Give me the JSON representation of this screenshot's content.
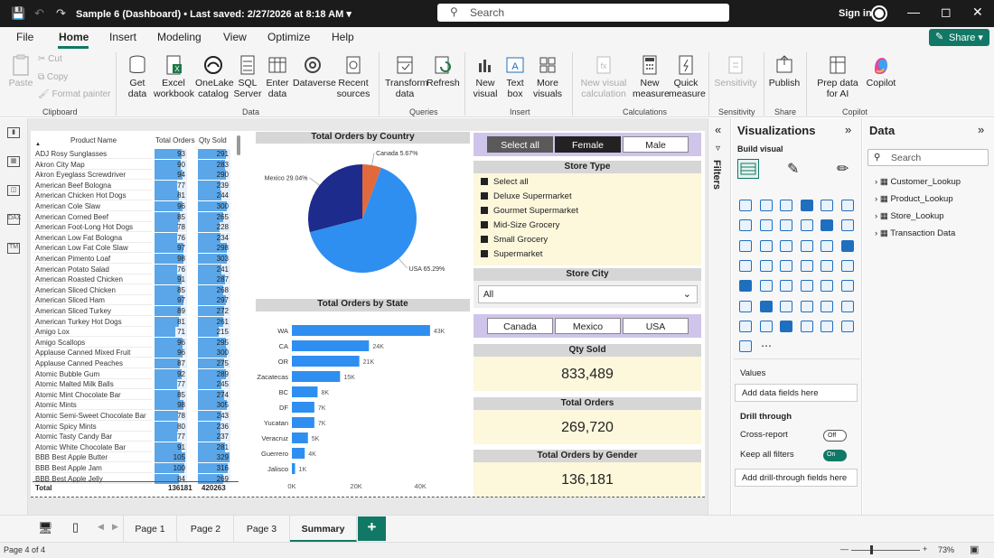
{
  "app": {
    "title": "Sample 6 (Dashboard)",
    "last_saved": "• Last saved: 2/27/2026 at 8:18 AM",
    "search_placeholder": "Search",
    "signin": "Sign in"
  },
  "menu": {
    "tabs": [
      "File",
      "Home",
      "Insert",
      "Modeling",
      "View",
      "Optimize",
      "Help"
    ],
    "active": "Home",
    "share": "Share"
  },
  "ribbon": {
    "clipboard": {
      "paste": "Paste",
      "cut": "Cut",
      "copy": "Copy",
      "format_painter": "Format painter",
      "group": "Clipboard"
    },
    "data": {
      "get_data": "Get data",
      "excel": "Excel workbook",
      "onelake": "OneLake catalog",
      "sql": "SQL Server",
      "enter": "Enter data",
      "dataverse": "Dataverse",
      "recent": "Recent sources",
      "group": "Data"
    },
    "queries": {
      "transform": "Transform data",
      "refresh": "Refresh",
      "group": "Queries"
    },
    "insert": {
      "new_visual": "New visual",
      "text_box": "Text box",
      "more_visuals": "More visuals",
      "group": "Insert"
    },
    "calculations": {
      "new_visual_calc": "New visual calculation",
      "new_measure": "New measure",
      "quick_measure": "Quick measure",
      "group": "Calculations"
    },
    "sensitivity": {
      "sensitivity": "Sensitivity",
      "group": "Sensitivity"
    },
    "share": {
      "publish": "Publish",
      "group": "Share"
    },
    "copilot": {
      "prep": "Prep data for AI",
      "copilot": "Copilot",
      "group": "Copilot"
    }
  },
  "table": {
    "headers": {
      "product": "Product Name",
      "orders": "Total Orders",
      "qty": "Qty Sold"
    },
    "rows": [
      [
        "ADJ Rosy Sunglasses",
        "93",
        "291"
      ],
      [
        "Akron City Map",
        "90",
        "283"
      ],
      [
        "Akron Eyeglass Screwdriver",
        "94",
        "290"
      ],
      [
        "American Beef Bologna",
        "77",
        "239"
      ],
      [
        "American Chicken Hot Dogs",
        "81",
        "244"
      ],
      [
        "American Cole Slaw",
        "96",
        "300"
      ],
      [
        "American Corned Beef",
        "85",
        "265"
      ],
      [
        "American Foot-Long Hot Dogs",
        "78",
        "228"
      ],
      [
        "American Low Fat Bologna",
        "76",
        "234"
      ],
      [
        "American Low Fat Cole Slaw",
        "97",
        "298"
      ],
      [
        "American Pimento Loaf",
        "98",
        "303"
      ],
      [
        "American Potato Salad",
        "76",
        "241"
      ],
      [
        "American Roasted Chicken",
        "91",
        "287"
      ],
      [
        "American Sliced Chicken",
        "85",
        "268"
      ],
      [
        "American Sliced Ham",
        "97",
        "297"
      ],
      [
        "American Sliced Turkey",
        "89",
        "272"
      ],
      [
        "American Turkey Hot Dogs",
        "81",
        "261"
      ],
      [
        "Amigo Lox",
        "71",
        "215"
      ],
      [
        "Amigo Scallops",
        "96",
        "295"
      ],
      [
        "Applause Canned Mixed Fruit",
        "96",
        "300"
      ],
      [
        "Applause Canned Peaches",
        "87",
        "275"
      ],
      [
        "Atomic Bubble Gum",
        "92",
        "289"
      ],
      [
        "Atomic Malted Milk Balls",
        "77",
        "245"
      ],
      [
        "Atomic Mint Chocolate Bar",
        "85",
        "274"
      ],
      [
        "Atomic Mints",
        "98",
        "305"
      ],
      [
        "Atomic Semi-Sweet Chocolate Bar",
        "78",
        "243"
      ],
      [
        "Atomic Spicy Mints",
        "80",
        "236"
      ],
      [
        "Atomic Tasty Candy Bar",
        "77",
        "237"
      ],
      [
        "Atomic White Chocolate Bar",
        "91",
        "281"
      ],
      [
        "BBB Best Apple Butter",
        "105",
        "329"
      ],
      [
        "BBB Best Apple Jam",
        "100",
        "316"
      ],
      [
        "BBB Best Apple Jelly",
        "84",
        "269"
      ]
    ],
    "total": {
      "label": "Total",
      "orders": "136181",
      "qty": "420263"
    }
  },
  "pie": {
    "title": "Total Orders by Country",
    "labels": [
      "Mexico 29.04%",
      "Canada 5.67%",
      "USA 65.29%"
    ]
  },
  "bar": {
    "title": "Total Orders by State",
    "ticks": [
      "0K",
      "20K",
      "40K"
    ]
  },
  "chart_data": [
    {
      "type": "pie",
      "title": "Total Orders by Country",
      "categories": [
        "USA",
        "Mexico",
        "Canada"
      ],
      "values": [
        65.29,
        29.04,
        5.67
      ],
      "colors": [
        "#2f8ff0",
        "#1c2b8c",
        "#e06a3b"
      ]
    },
    {
      "type": "bar",
      "orientation": "horizontal",
      "title": "Total Orders by State",
      "categories": [
        "WA",
        "CA",
        "OR",
        "Zacatecas",
        "BC",
        "DF",
        "Yucatan",
        "Veracruz",
        "Guerrero",
        "Jalisco"
      ],
      "values": [
        43,
        24,
        21,
        15,
        8,
        7,
        7,
        5,
        4,
        1
      ],
      "value_labels": [
        "43K",
        "24K",
        "21K",
        "15K",
        "8K",
        "7K",
        "7K",
        "5K",
        "4K",
        "1K"
      ],
      "xlim": [
        0,
        45
      ],
      "color": "#2f8ff0"
    }
  ],
  "slicers": {
    "gender": [
      "Select all",
      "Female",
      "Male"
    ],
    "store_type_title": "Store Type",
    "store_types": [
      "Select all",
      "Deluxe Supermarket",
      "Gourmet Supermarket",
      "Mid-Size Grocery",
      "Small Grocery",
      "Supermarket"
    ],
    "store_city_title": "Store City",
    "store_city_value": "All",
    "countries": [
      "Canada",
      "Mexico",
      "USA"
    ]
  },
  "cards": [
    {
      "title": "Qty Sold",
      "value": "833,489"
    },
    {
      "title": "Total Orders",
      "value": "269,720"
    },
    {
      "title": "Total Orders by Gender",
      "value": "136,181"
    }
  ],
  "pages": [
    "Page 1",
    "Page 2",
    "Page 3",
    "Summary"
  ],
  "status": {
    "page": "Page 4 of 4",
    "zoom": "73%"
  },
  "filters_label": "Filters",
  "visualizations": {
    "title": "Visualizations",
    "build": "Build visual",
    "values": "Values",
    "add_fields": "Add data fields here",
    "drill": "Drill through",
    "cross": "Cross-report",
    "cross_state": "Off",
    "keep": "Keep all filters",
    "keep_state": "On",
    "add_drill": "Add drill-through fields here"
  },
  "data_pane": {
    "title": "Data",
    "search": "Search",
    "tables": [
      "Customer_Lookup",
      "Product_Lookup",
      "Store_Lookup",
      "Transaction Data"
    ]
  }
}
